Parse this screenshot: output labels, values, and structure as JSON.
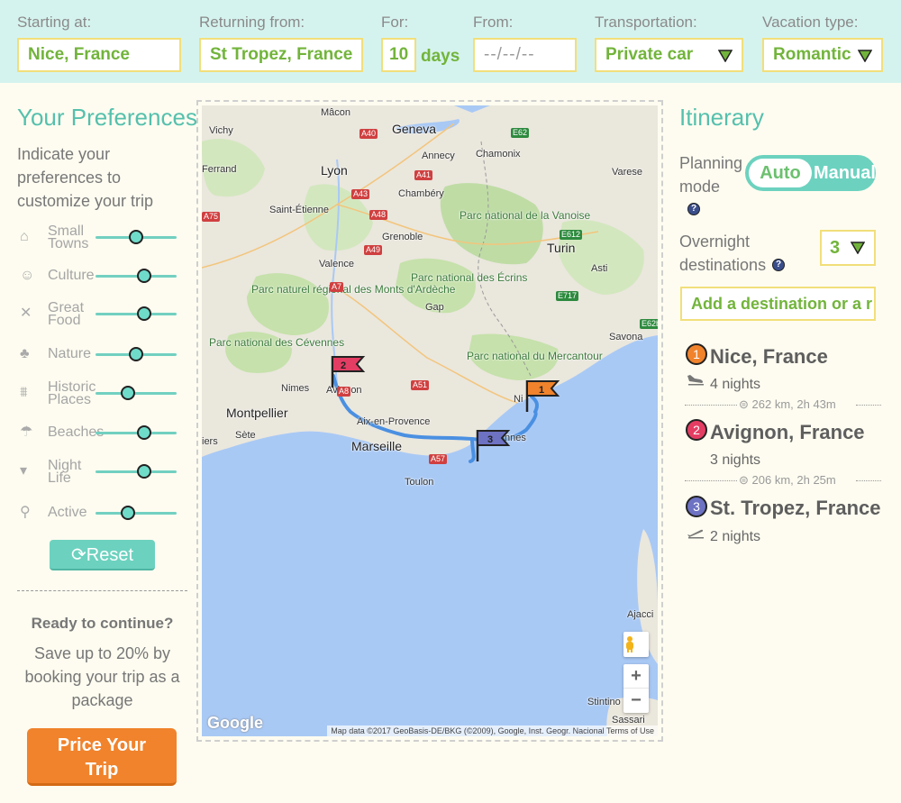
{
  "top": {
    "starting_label": "Starting at:",
    "starting_value": "Nice, France",
    "returning_label": "Returning from:",
    "returning_value": "St Tropez, France",
    "for_label": "For:",
    "for_value": "10",
    "days_label": "days",
    "from_label": "From:",
    "from_placeholder": "--/--/--",
    "transport_label": "Transportation:",
    "transport_value": "Private car",
    "vacation_label": "Vacation type:",
    "vacation_value": "Romantic"
  },
  "preferences": {
    "title": "Your Preferences",
    "intro": "Indicate your preferences to customize your trip",
    "items": [
      {
        "label_1": "Small",
        "label_2": "Towns",
        "icon": "house-icon",
        "level": 0.5
      },
      {
        "label_1": "Culture",
        "label_2": "",
        "icon": "theater-masks-icon",
        "level": 0.6
      },
      {
        "label_1": "Great",
        "label_2": "Food",
        "icon": "fork-knife-icon",
        "level": 0.6
      },
      {
        "label_1": "Nature",
        "label_2": "",
        "icon": "tree-icon",
        "level": 0.5
      },
      {
        "label_1": "Historic",
        "label_2": "Places",
        "icon": "museum-icon",
        "level": 0.4
      },
      {
        "label_1": "Beaches",
        "label_2": "",
        "icon": "beach-umbrella-icon",
        "level": 0.6
      },
      {
        "label_1": "Night",
        "label_2": "Life",
        "icon": "cocktail-icon",
        "level": 0.6
      },
      {
        "label_1": "Active",
        "label_2": "",
        "icon": "hikers-icon",
        "level": 0.4
      }
    ],
    "reset_label": "Reset",
    "ready_title": "Ready to continue?",
    "save_text": "Save up to 20% by booking your trip as a package",
    "price_line_1": "Price Your",
    "price_line_2": "Trip"
  },
  "map": {
    "labels": {
      "macon": "Mâcon",
      "geneva": "Geneva",
      "vichy": "Vichy",
      "annecy": "Annecy",
      "chamonix": "Chamonix",
      "ferrand": "Ferrand",
      "lyon": "Lyon",
      "varese": "Varese",
      "chambery": "Chambéry",
      "saint_etienne": "Saint-Étienne",
      "vanoise": "Parc national de la Vanoise",
      "grenoble": "Grenoble",
      "turin": "Turin",
      "valence": "Valence",
      "ecrins": "Parc national des Écrins",
      "asti": "Asti",
      "ardeche": "Parc naturel régional des Monts d'Ardèche",
      "gap": "Gap",
      "cevennes": "Parc national des Cévennes",
      "mercantour": "Parc national du Mercantour",
      "savona": "Savona",
      "avignon": "Avignon",
      "nimes": "Nimes",
      "montpellier": "Montpellier",
      "nice": "Ni",
      "aix": "Aix-en-Provence",
      "iers": "iers",
      "sete": "Sète",
      "marseille": "Marseille",
      "nnes": "nnes",
      "toulon": "Toulon",
      "ajacci": "Ajacci",
      "stintino": "Stintino",
      "sassari": "Sassari"
    },
    "roads": [
      "E62",
      "A40",
      "A41",
      "A75",
      "A43",
      "A48",
      "A49",
      "A7",
      "A51",
      "A8",
      "A57",
      "E612",
      "E717",
      "E62b"
    ],
    "google": "Google",
    "attribution": "Map data ©2017 GeoBasis-DE/BKG (©2009), Google, Inst. Geogr. Nacional   Terms of Use",
    "zoom_in": "+",
    "zoom_out": "−",
    "flags": [
      "1",
      "2",
      "3"
    ]
  },
  "itinerary": {
    "title": "Itinerary",
    "planning_label_1": "Planning",
    "planning_label_2": "mode",
    "auto": "Auto",
    "manual": "Manual",
    "overnight_label_1": "Overnight",
    "overnight_label_2": "destinations",
    "overnight_value": "3",
    "add_destination": "Add a destination or a r",
    "stops": [
      {
        "num": "1",
        "name": "Nice, France",
        "nights": "4 nights",
        "color": "#f0832c"
      },
      {
        "num": "2",
        "name": "Avignon, France",
        "nights": "3 nights",
        "color": "#e43d63"
      },
      {
        "num": "3",
        "name": "St. Tropez, France",
        "nights": "2 nights",
        "color": "#6d72c3"
      }
    ],
    "legs": [
      "262 km, 2h 43m",
      "206 km, 2h 25m"
    ],
    "help": "?"
  },
  "colors": {
    "accent_teal": "#55c0ad",
    "topbar_bg": "#d5f3ee",
    "input_text_green": "#72b43b",
    "input_border_yellow": "#f1df7a",
    "price_orange": "#f0832c",
    "route_blue": "#4a90e2"
  }
}
